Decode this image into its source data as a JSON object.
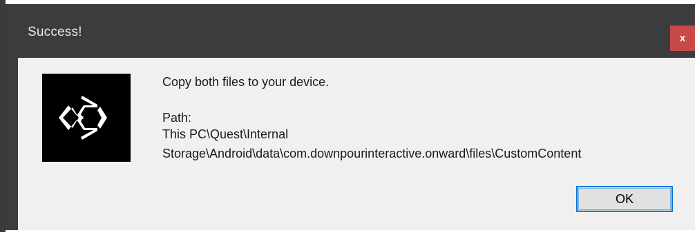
{
  "dialog": {
    "title": "Success!",
    "close_label": "x",
    "logo_icon": "unity-logo-icon",
    "message": "Copy both files to your device.",
    "path_label": "Path:",
    "path_line_1": "This PC\\Quest\\Internal",
    "path_line_2": "Storage\\Android\\data\\com.downpourinteractive.onward\\files\\CustomContent",
    "ok_label": "OK"
  },
  "colors": {
    "titlebar": "#3c3c3c",
    "close_button": "#c94848",
    "content_background": "#f0f0f0",
    "ok_border": "#0078d7"
  }
}
